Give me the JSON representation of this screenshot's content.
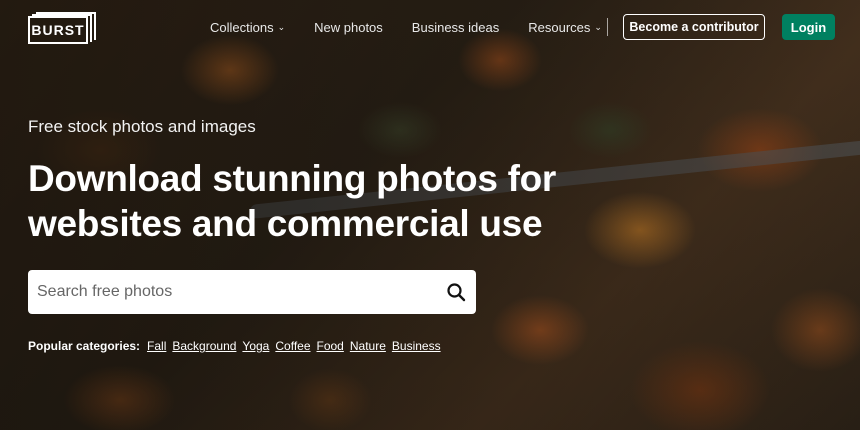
{
  "header": {
    "logo_text": "BURST",
    "nav": [
      {
        "label": "Collections",
        "has_dropdown": true
      },
      {
        "label": "New photos",
        "has_dropdown": false
      },
      {
        "label": "Business ideas",
        "has_dropdown": false
      },
      {
        "label": "Resources",
        "has_dropdown": true
      }
    ],
    "contributor_button": "Become a contributor",
    "login_button": "Login"
  },
  "hero": {
    "subtitle": "Free stock photos and images",
    "title": "Download stunning photos for websites and commercial use",
    "search": {
      "placeholder": "Search free photos",
      "icon": "search-icon"
    },
    "popular": {
      "label": "Popular categories:",
      "categories": [
        "Fall",
        "Background",
        "Yoga",
        "Coffee",
        "Food",
        "Nature",
        "Business"
      ]
    }
  },
  "colors": {
    "login_bg": "#008060",
    "text": "#ffffff",
    "search_bg": "#ffffff"
  }
}
